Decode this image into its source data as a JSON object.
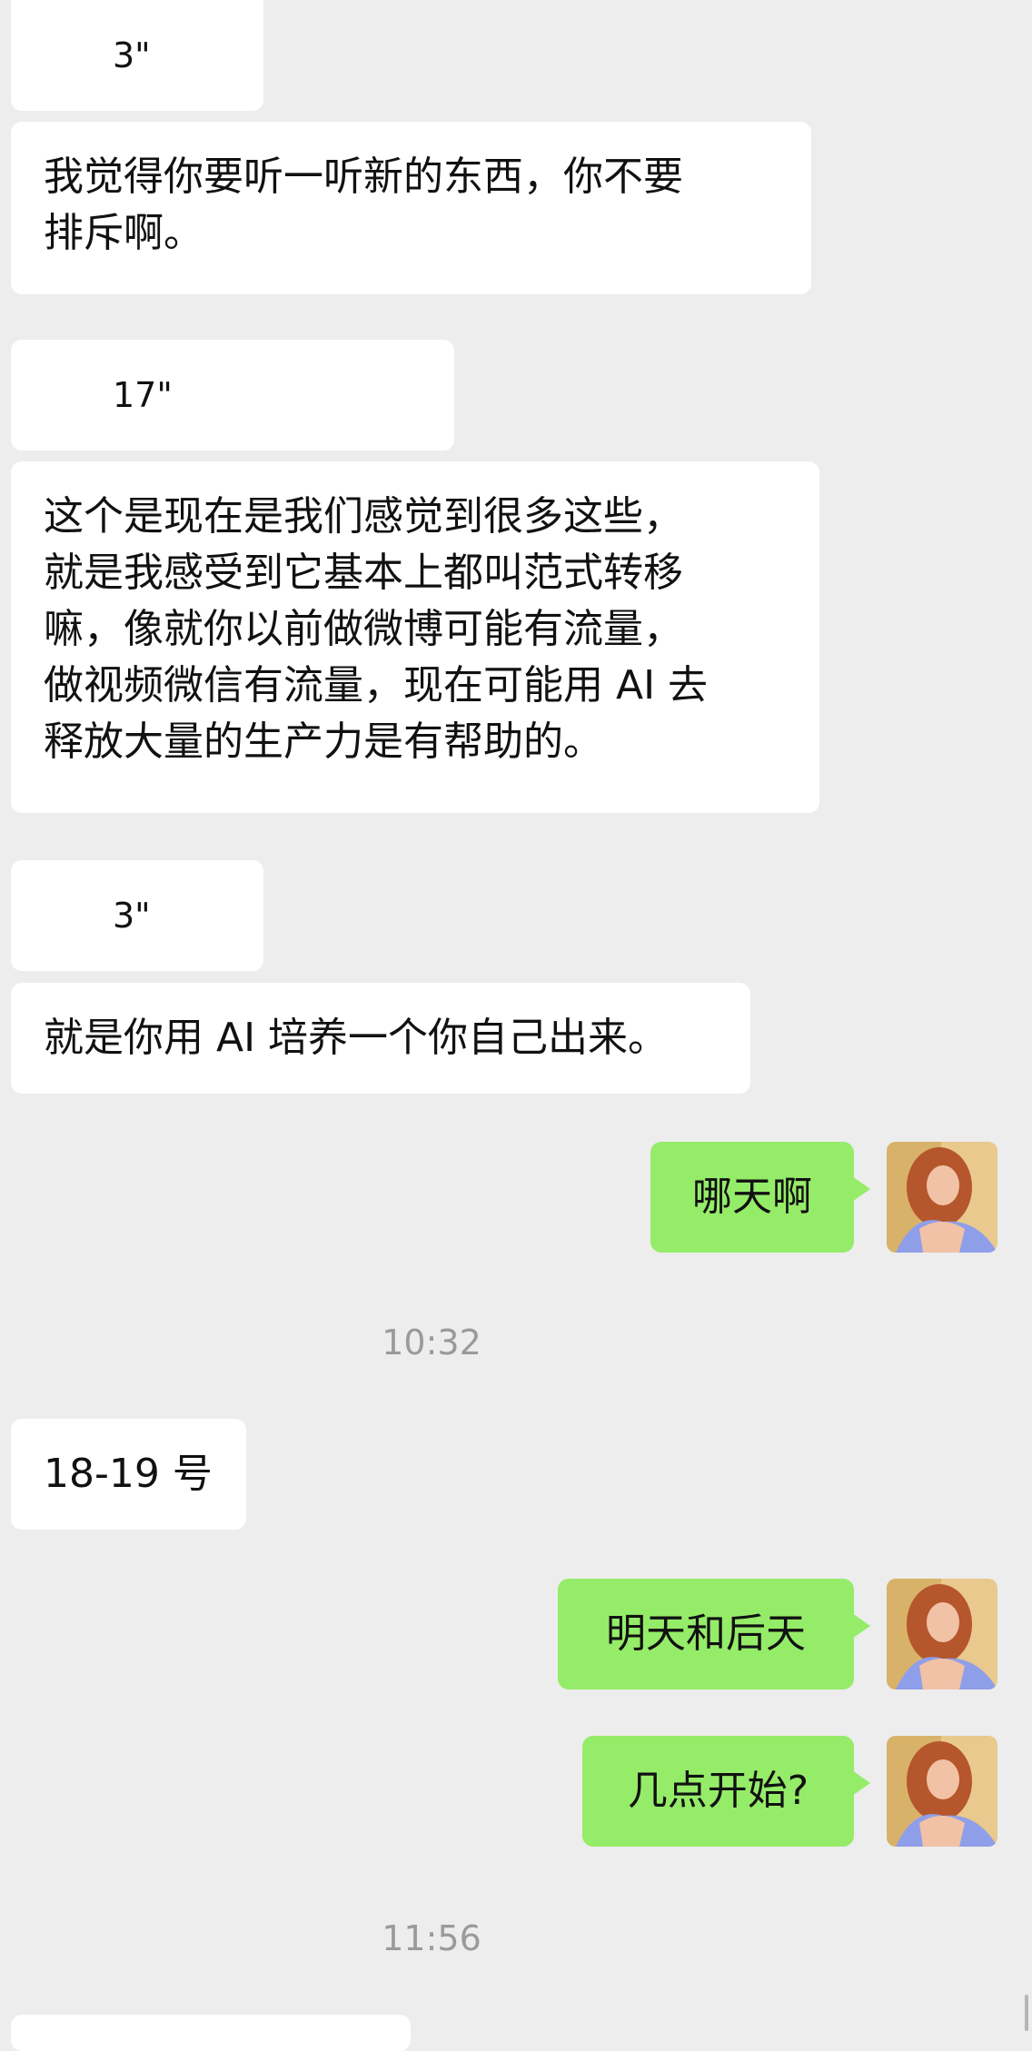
{
  "messages": {
    "m1": {
      "duration": "3\""
    },
    "m2": {
      "text": "我觉得你要听一听新的东西，你不要\n排斥啊。"
    },
    "m3": {
      "duration": "17\""
    },
    "m4": {
      "text": "这个是现在是我们感觉到很多这些，\n就是我感受到它基本上都叫范式转移\n嘛，像就你以前做微博可能有流量，\n做视频微信有流量，现在可能用 AI 去\n释放大量的生产力是有帮助的。"
    },
    "m5": {
      "duration": "3\""
    },
    "m6": {
      "text": "就是你用 AI 培养一个你自己出来。"
    },
    "m7": {
      "text": "哪天啊"
    },
    "t1": {
      "text": "10:32"
    },
    "m8": {
      "text": "18-19 号"
    },
    "m9": {
      "text": "明天和后天"
    },
    "m10": {
      "text": "几点开始?"
    },
    "t2": {
      "text": "11:56"
    }
  },
  "colors": {
    "background": "#ededed",
    "incoming_bubble": "#ffffff",
    "outgoing_bubble": "#95ec69",
    "timestamp": "#9a9a9a"
  },
  "icons": {
    "voice": "voice-wave-icon",
    "avatar": "user-avatar"
  }
}
